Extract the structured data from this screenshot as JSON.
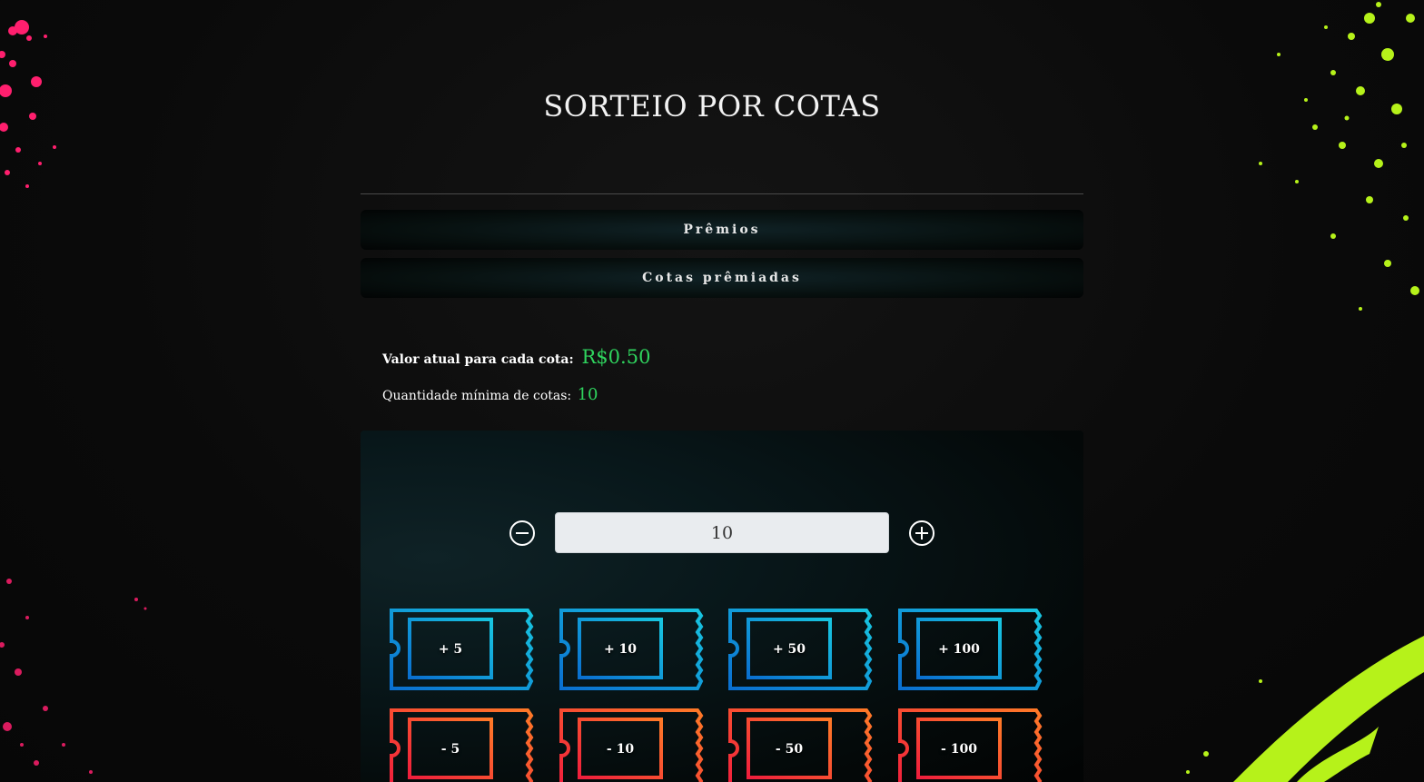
{
  "page": {
    "title": "SORTEIO POR COTAS"
  },
  "accordions": [
    {
      "label": "Prêmios"
    },
    {
      "label": "Cotas prêmiadas"
    }
  ],
  "info": {
    "price_label": "Valor atual para cada cota:",
    "price_value": "R$0.50",
    "min_label": "Quantidade mínima de cotas:",
    "min_value": "10"
  },
  "selector": {
    "quantity": "10",
    "minus_icon": "minus-circle-icon",
    "plus_icon": "plus-circle-icon",
    "add_buttons": [
      "+ 5",
      "+ 10",
      "+ 50",
      "+ 100"
    ],
    "remove_buttons": [
      "- 5",
      "- 10",
      "- 50",
      "- 100"
    ]
  },
  "colors": {
    "accent_green": "#2fd45e",
    "ticket_add_start": "#0a6fd0",
    "ticket_add_end": "#18c6e0",
    "ticket_remove_start": "#f01e3c",
    "ticket_remove_end": "#ff7a28",
    "splash_pink": "#ff1f6e",
    "splash_lime": "#b6f21a"
  }
}
